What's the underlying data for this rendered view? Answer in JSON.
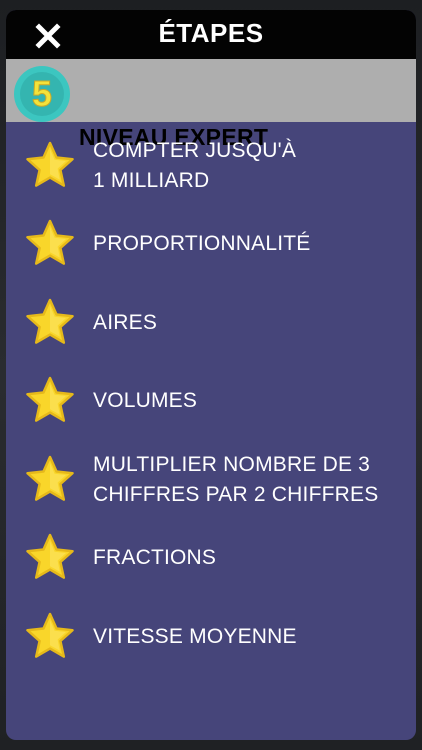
{
  "header": {
    "title": "ÉTAPES",
    "close_icon": "close-icon"
  },
  "level": {
    "number": "5",
    "label": "NIVEAU EXPERT",
    "badge_color": "#3cc6c0",
    "badge_number_color": "#f3e33a"
  },
  "colors": {
    "panel_bg": "#46457a",
    "topbar_bg": "#030303",
    "level_bar_bg": "#aeaeae",
    "star_fill": "#f9d62a"
  },
  "steps": [
    {
      "label": "COMPTER JUSQU'À\n1 MILLIARD",
      "icon": "star-icon"
    },
    {
      "label": "PROPORTIONNALITÉ",
      "icon": "star-icon"
    },
    {
      "label": "AIRES",
      "icon": "star-icon"
    },
    {
      "label": "VOLUMES",
      "icon": "star-icon"
    },
    {
      "label": "MULTIPLIER NOMBRE DE 3\nCHIFFRES PAR 2 CHIFFRES",
      "icon": "star-icon"
    },
    {
      "label": "FRACTIONS",
      "icon": "star-icon"
    },
    {
      "label": "VITESSE MOYENNE",
      "icon": "star-icon"
    }
  ]
}
